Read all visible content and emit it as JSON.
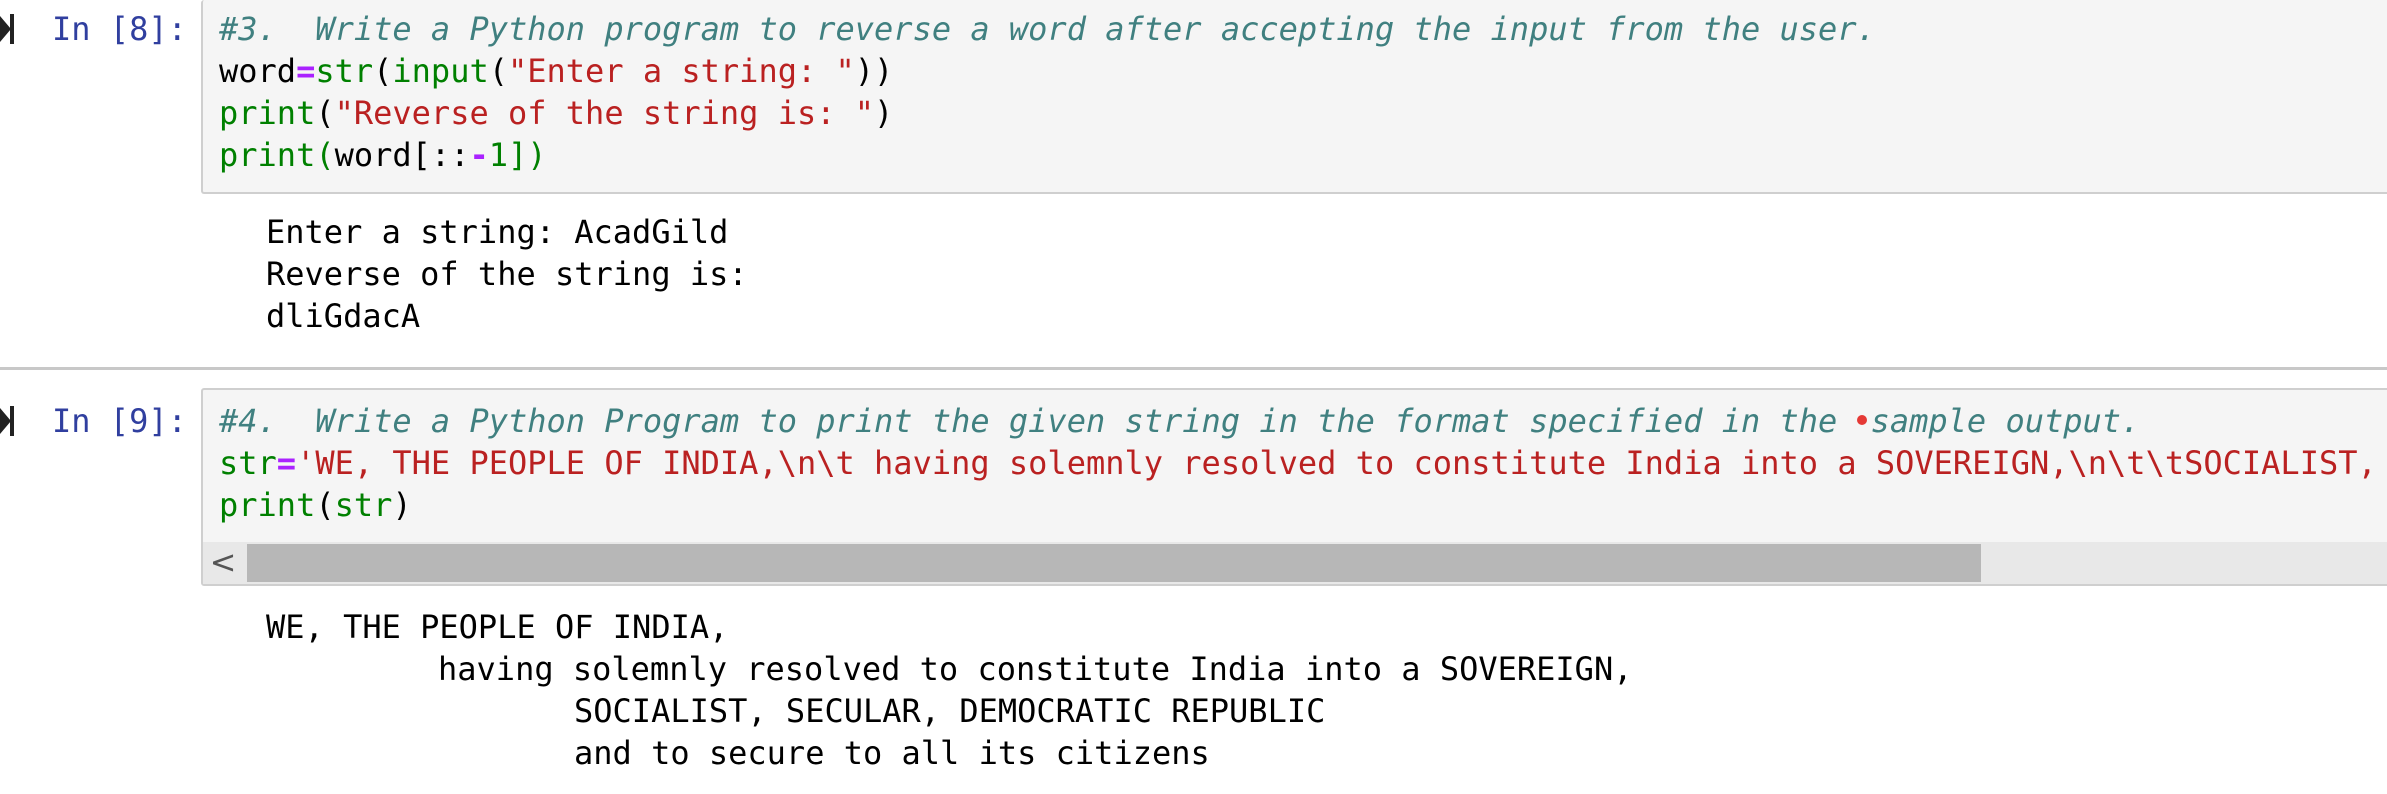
{
  "cells": [
    {
      "prompt": "In [8]:",
      "code": {
        "line1": "#3.  Write a Python program to reverse a word after accepting the input from the user.",
        "line2": {
          "name": "word",
          "op": "=",
          "fn1": "str",
          "p1": "(",
          "fn2": "input",
          "p2": "(",
          "str": "\"Enter a string: \"",
          "p3": "))"
        },
        "line3": {
          "fn": "print",
          "p1": "(",
          "str": "\"Reverse of the string is: \"",
          "p2": ")"
        },
        "line4": {
          "fn": "print",
          "p1": "(",
          "name": "word[::",
          "op": "-",
          "num": "1",
          "p2": "])"
        }
      },
      "output": [
        "Enter a string: AcadGild",
        "Reverse of the string is:",
        "dliGdacA"
      ]
    },
    {
      "prompt": "In [9]:",
      "code": {
        "line1a": "#4.  Write a Python Program to print the given string in the format specified in the ",
        "line1b": "sample output.",
        "line2": {
          "name": "str",
          "op": "=",
          "str": "'WE, THE PEOPLE OF INDIA,\\n\\t having solemnly resolved to constitute India into a SOVEREIGN,\\n\\t\\tSOCIALIST,"
        },
        "line3": {
          "fn": "print",
          "p1": "(",
          "arg": "str",
          "p2": ")"
        }
      },
      "scroll_arrow": "<",
      "output": [
        "WE, THE PEOPLE OF INDIA,",
        "having solemnly resolved to constitute India into a SOVEREIGN,",
        "SOCIALIST, SECULAR, DEMOCRATIC REPUBLIC",
        "and to secure to all its citizens"
      ]
    }
  ]
}
